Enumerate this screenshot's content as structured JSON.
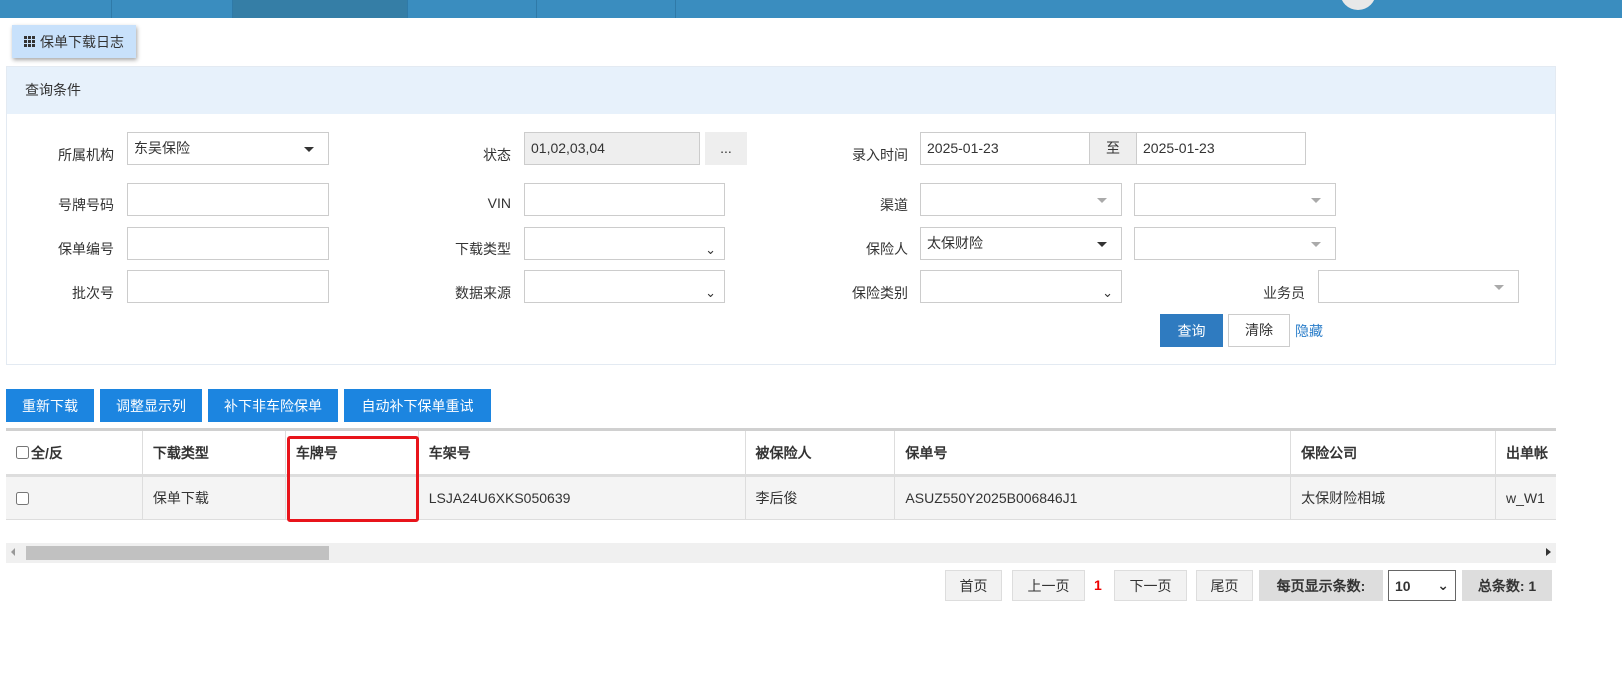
{
  "header": {
    "tab_title": "保单下载日志"
  },
  "query": {
    "title": "查询条件",
    "org_label": "所属机构",
    "org_value": "东吴保险",
    "status_label": "状态",
    "status_value": "01,02,03,04",
    "status_more": "...",
    "entry_time_label": "录入时间",
    "date_from": "2025-01-23",
    "date_to_label": "至",
    "date_to": "2025-01-23",
    "plate_label": "号牌号码",
    "vin_label": "VIN",
    "channel_label": "渠道",
    "policy_no_label": "保单编号",
    "download_type_label": "下载类型",
    "insurer_label": "保险人",
    "insurer_value": "太保财险",
    "batch_label": "批次号",
    "data_source_label": "数据来源",
    "insurance_type_label": "保险类别",
    "salesman_label": "业务员",
    "search_btn": "查询",
    "clear_btn": "清除",
    "hide_link": "隐藏"
  },
  "toolbar": {
    "redownload": "重新下载",
    "adjust_columns": "调整显示列",
    "non_vehicle": "补下非车险保单",
    "auto_retry": "自动补下保单重试"
  },
  "table": {
    "headers": [
      "全/反",
      "下载类型",
      "车牌号",
      "车架号",
      "被保险人",
      "保单号",
      "保险公司",
      "出单帐"
    ],
    "rows": [
      {
        "download_type": "保单下载",
        "plate": "",
        "vin": "LSJA24U6XKS050639",
        "insured": "李后俊",
        "policy_no": "ASUZ550Y2025B006846J1",
        "company": "太保财险相城",
        "issuer": "w_W1"
      }
    ]
  },
  "pagination": {
    "first": "首页",
    "prev": "上一页",
    "current": "1",
    "next": "下一页",
    "last": "尾页",
    "page_size_label": "每页显示条数:",
    "page_size": "10",
    "total": "总条数: 1"
  }
}
